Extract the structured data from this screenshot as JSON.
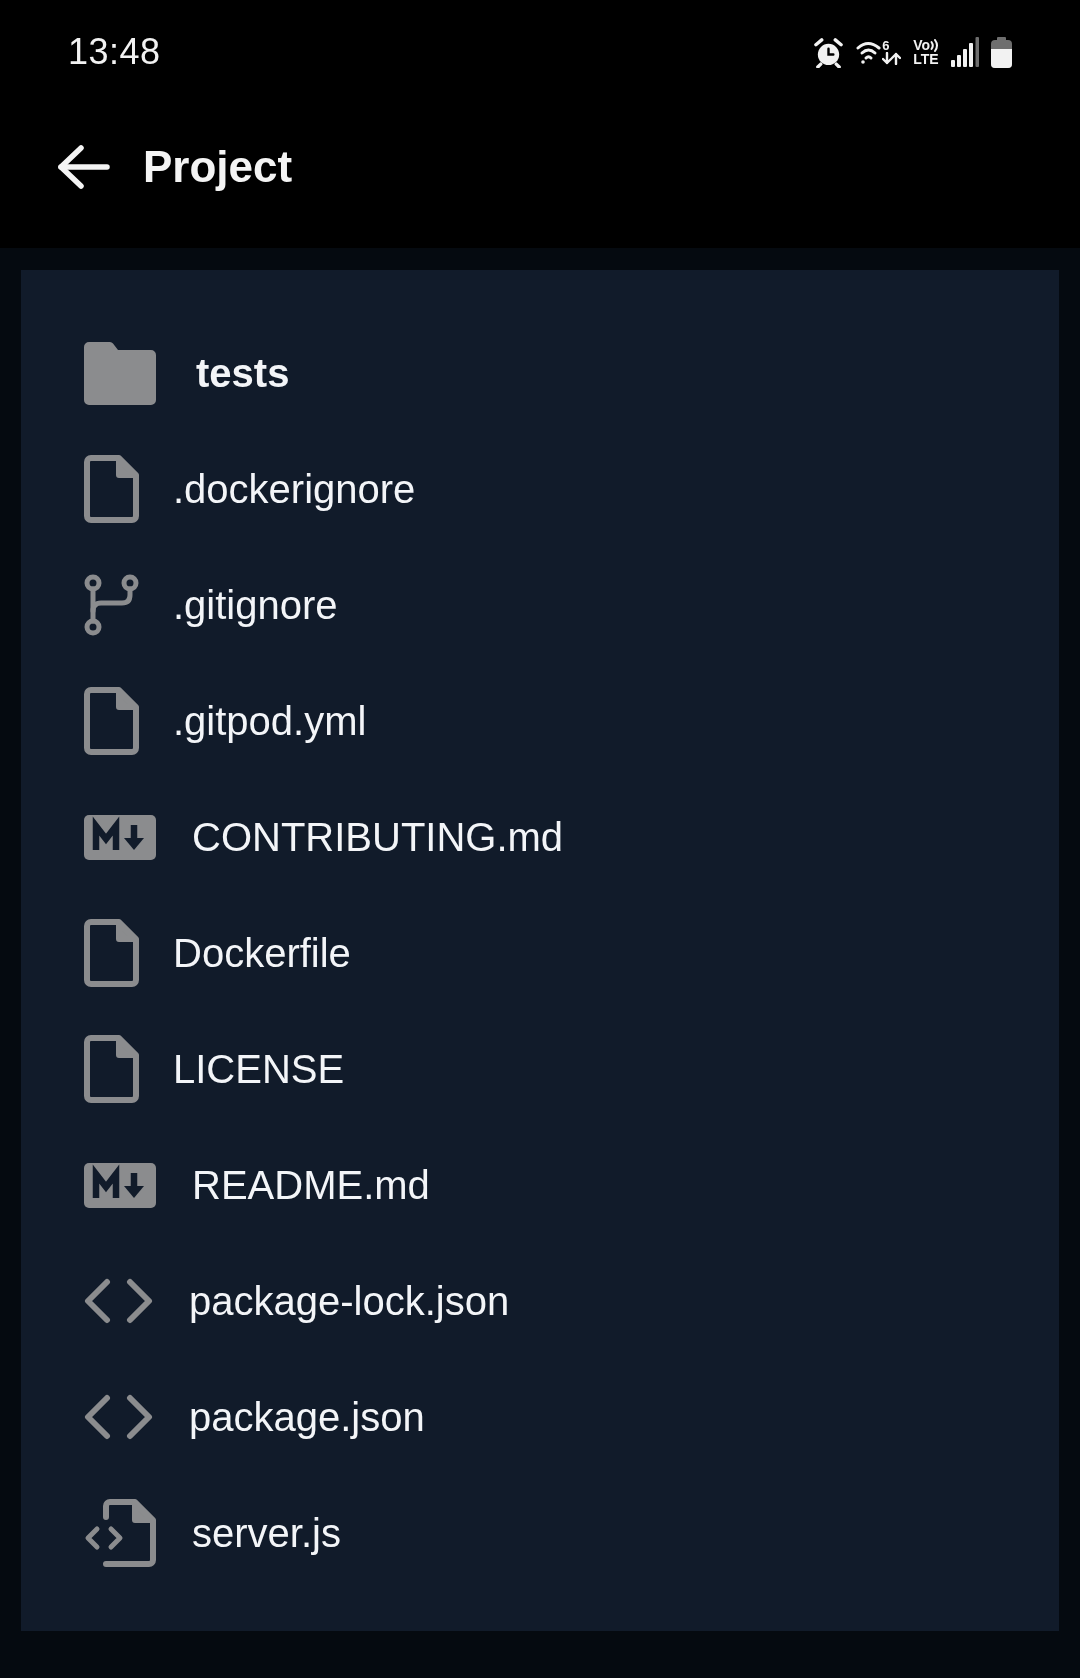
{
  "status_bar": {
    "time": "13:48",
    "wifi_badge": "6",
    "volte": {
      "line_1": "Vo",
      "line_2": "LTE"
    }
  },
  "header": {
    "title": "Project"
  },
  "files": [
    {
      "name": "tests",
      "kind": "folder"
    },
    {
      "name": ".dockerignore",
      "kind": "file"
    },
    {
      "name": ".gitignore",
      "kind": "git"
    },
    {
      "name": ".gitpod.yml",
      "kind": "file"
    },
    {
      "name": "CONTRIBUTING.md",
      "kind": "markdown"
    },
    {
      "name": "Dockerfile",
      "kind": "file"
    },
    {
      "name": "LICENSE",
      "kind": "file"
    },
    {
      "name": "README.md",
      "kind": "markdown"
    },
    {
      "name": "package-lock.json",
      "kind": "code"
    },
    {
      "name": "package.json",
      "kind": "code"
    },
    {
      "name": "server.js",
      "kind": "script"
    }
  ]
}
